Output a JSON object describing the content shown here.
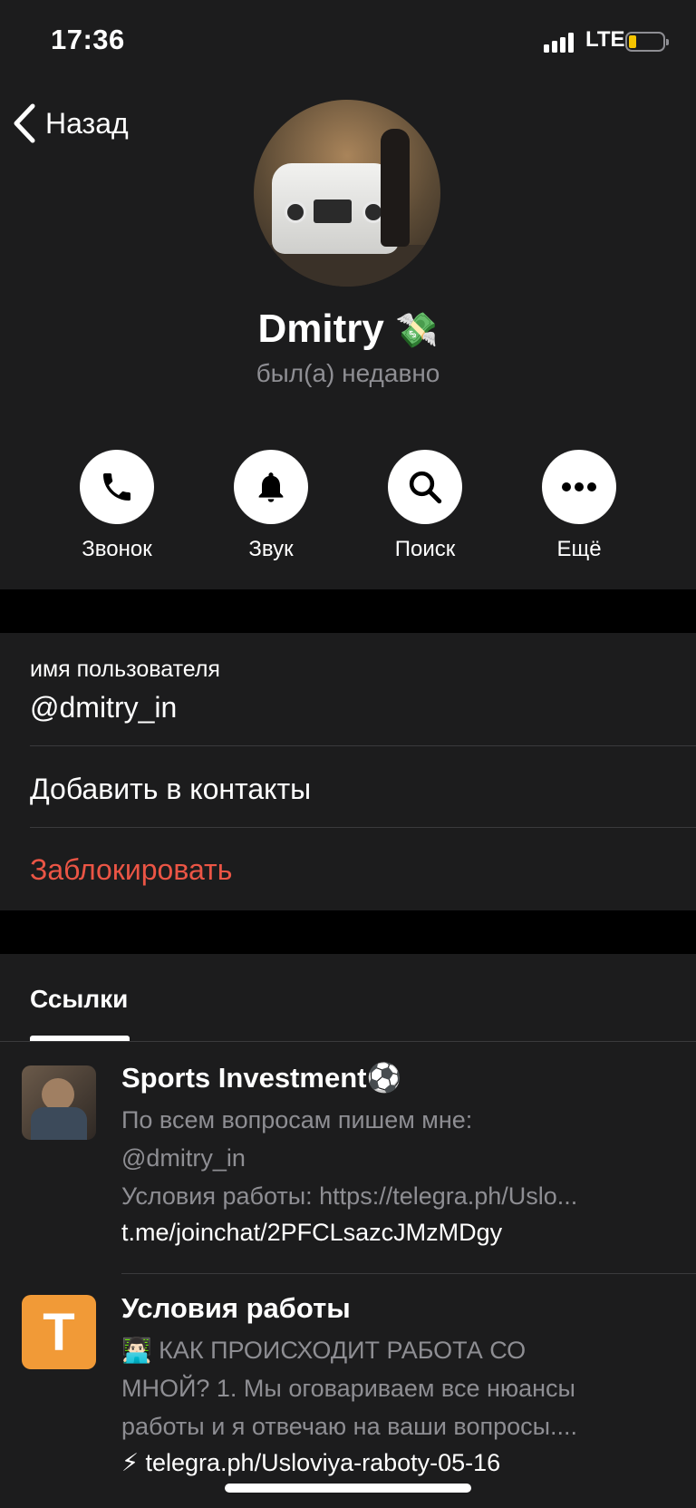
{
  "status_bar": {
    "time": "17:36",
    "network": "LTE"
  },
  "nav": {
    "back_label": "Назад"
  },
  "profile": {
    "name": "Dmitry",
    "name_emoji": "💸",
    "status": "был(а) недавно"
  },
  "actions": [
    {
      "label": "Звонок",
      "icon": "phone-icon"
    },
    {
      "label": "Звук",
      "icon": "bell-icon"
    },
    {
      "label": "Поиск",
      "icon": "search-icon"
    },
    {
      "label": "Ещё",
      "icon": "more-icon"
    }
  ],
  "info": {
    "username_label": "имя пользователя",
    "username_value": "@dmitry_in",
    "add_contact": "Добавить в контакты",
    "block": "Заблокировать"
  },
  "tabs": {
    "links": "Ссылки"
  },
  "links": [
    {
      "title": "Sports Investment⚽",
      "desc_line1": "По всем вопросам пишем мне:",
      "desc_line2": "@dmitry_in",
      "desc_line3": "Условия работы: https://telegra.ph/Uslo...",
      "url": "t.me/joinchat/2PFCLsazcJMzMDgy"
    },
    {
      "title": "Условия работы",
      "thumb_letter": "T",
      "desc_line1": "👨🏻‍💻 КАК ПРОИСХОДИТ РАБОТА СО",
      "desc_line2": "МНОЙ?  1. Мы оговариваем все нюансы",
      "desc_line3": "работы и я отвечаю на ваши вопросы....",
      "url_prefix": "⚡",
      "url": "telegra.ph/Usloviya-raboty-05-16"
    }
  ],
  "colors": {
    "background": "#1c1c1d",
    "destructive": "#eb5545",
    "secondary_text": "#8e8e93",
    "thumb_orange": "#f19a37"
  }
}
